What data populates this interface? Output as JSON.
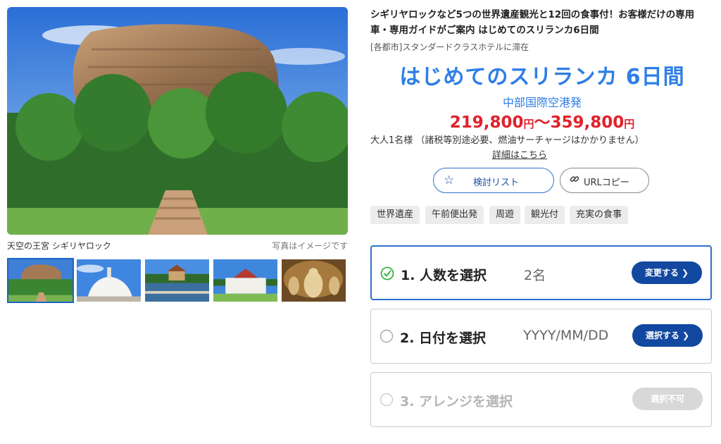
{
  "gallery": {
    "caption_left": "天空の王宮 シギリヤロック",
    "caption_right": "写真はイメージです",
    "thumbnails": [
      {
        "icon": "sigiriya-rock-thumb"
      },
      {
        "icon": "white-stupa-thumb"
      },
      {
        "icon": "temple-lake-thumb"
      },
      {
        "icon": "tooth-temple-thumb"
      },
      {
        "icon": "cave-buddha-thumb"
      }
    ]
  },
  "tour": {
    "title_line1": "シギリヤロックなど5つの世界遺産観光と12回の食事付！お客様だけの専用",
    "title_line2": "車・専用ガイドがご案内 はじめてのスリランカ6日間",
    "hotel_note": "[各都市]スタンダードクラスホテルに滞在",
    "big_title": "はじめてのスリランカ 6日間",
    "departure": "中部国際空港発",
    "price_low": "219,800",
    "price_high": "359,800",
    "yen": "円",
    "tilde": "〜",
    "price_note": "大人1名様 （諸税等別途必要、燃油サーチャージはかかりません）",
    "detail_link": "詳細はこちら"
  },
  "actions": {
    "favorite_label": "検討リスト",
    "url_copy_label": "URLコピー"
  },
  "tags": [
    "世界遺産",
    "午前便出発",
    "周遊",
    "観光付",
    "充実の食事"
  ],
  "steps": [
    {
      "label": "1. 人数を選択",
      "value": "2名",
      "button": "変更する ❯",
      "state": "done"
    },
    {
      "label": "2. 日付を選択",
      "value": "YYYY/MM/DD",
      "button": "選択する ❯",
      "state": "open"
    },
    {
      "label": "3. アレンジを選択",
      "value": "",
      "button": "選択不可",
      "state": "disabled"
    }
  ],
  "colors": {
    "accent_blue": "#2e7fe5",
    "button_navy": "#12489f",
    "price_red": "#e0222b",
    "check_green": "#3cb043"
  }
}
